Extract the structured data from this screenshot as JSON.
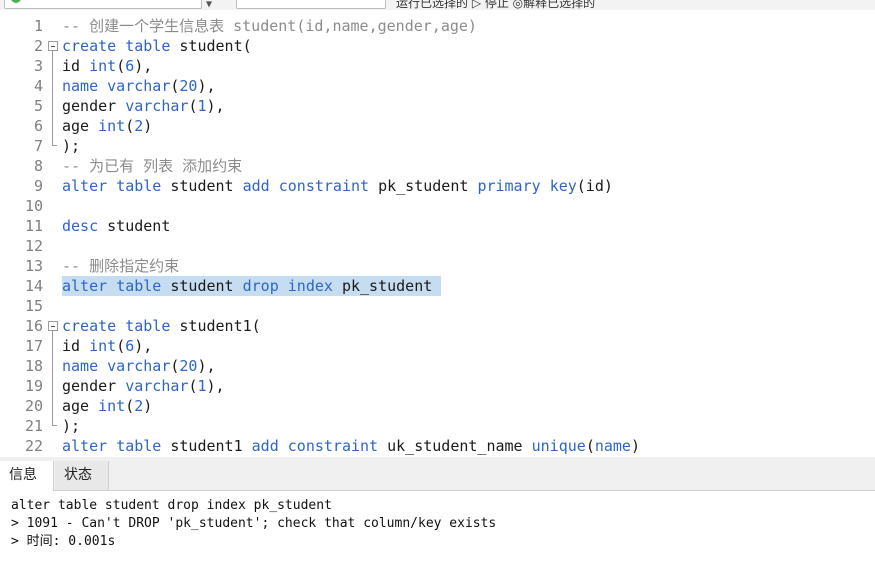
{
  "toolbar": {
    "hint": "运行已选择的 ▷ 停止 ◎解释已选择的"
  },
  "editor": {
    "lines": [
      {
        "n": "1",
        "t": [
          [
            "cmt",
            "-- 创建一个学生信息表 student(id,name,gender,age)"
          ]
        ]
      },
      {
        "n": "2",
        "t": [
          [
            "kw",
            "create"
          ],
          [
            "",
            ""
          ],
          [
            "",
            ""
          ],
          [
            "kw",
            " table"
          ],
          [
            "",
            " student("
          ]
        ]
      },
      {
        "n": "3",
        "t": [
          [
            "",
            "id "
          ],
          [
            "kw",
            "int"
          ],
          [
            "",
            "("
          ],
          [
            "num",
            "6"
          ],
          [
            "",
            "),"
          ]
        ]
      },
      {
        "n": "4",
        "t": [
          [
            "kw",
            "name"
          ],
          [
            "",
            " "
          ],
          [
            "kw",
            "varchar"
          ],
          [
            "",
            "("
          ],
          [
            "num",
            "20"
          ],
          [
            "",
            "),"
          ]
        ]
      },
      {
        "n": "5",
        "t": [
          [
            "",
            "gender "
          ],
          [
            "kw",
            "varchar"
          ],
          [
            "",
            "("
          ],
          [
            "num",
            "1"
          ],
          [
            "",
            "),"
          ]
        ]
      },
      {
        "n": "6",
        "t": [
          [
            "",
            "age "
          ],
          [
            "kw",
            "int"
          ],
          [
            "",
            "("
          ],
          [
            "num",
            "2"
          ],
          [
            "",
            ")"
          ]
        ]
      },
      {
        "n": "7",
        "t": [
          [
            "",
            ");"
          ]
        ]
      },
      {
        "n": "8",
        "t": [
          [
            "cmt",
            "-- 为已有 列表 添加约束"
          ]
        ]
      },
      {
        "n": "9",
        "t": [
          [
            "kw",
            "alter"
          ],
          [
            "",
            " "
          ],
          [
            "kw",
            "table"
          ],
          [
            "",
            " student "
          ],
          [
            "kw",
            "add"
          ],
          [
            "",
            " "
          ],
          [
            "kw",
            "constraint"
          ],
          [
            "",
            " pk_student "
          ],
          [
            "kw",
            "primary"
          ],
          [
            "",
            " "
          ],
          [
            "kw",
            "key"
          ],
          [
            "",
            "(id)"
          ]
        ]
      },
      {
        "n": "10",
        "t": []
      },
      {
        "n": "11",
        "t": [
          [
            "kw",
            "desc"
          ],
          [
            "",
            " student"
          ]
        ]
      },
      {
        "n": "12",
        "t": []
      },
      {
        "n": "13",
        "t": [
          [
            "cmt",
            "-- 删除指定约束"
          ]
        ]
      },
      {
        "n": "14",
        "t": [
          [
            "kw",
            "alter"
          ],
          [
            "",
            " "
          ],
          [
            "kw",
            "table"
          ],
          [
            "",
            " student "
          ],
          [
            "kw",
            "drop"
          ],
          [
            "",
            " "
          ],
          [
            "kw",
            "index"
          ],
          [
            "",
            " pk_student "
          ]
        ],
        "selected": true
      },
      {
        "n": "15",
        "t": []
      },
      {
        "n": "16",
        "t": [
          [
            "kw",
            "create"
          ],
          [
            "",
            " "
          ],
          [
            "kw",
            "table"
          ],
          [
            "",
            " student1("
          ]
        ]
      },
      {
        "n": "17",
        "t": [
          [
            "",
            "id "
          ],
          [
            "kw",
            "int"
          ],
          [
            "",
            "("
          ],
          [
            "num",
            "6"
          ],
          [
            "",
            "),"
          ]
        ]
      },
      {
        "n": "18",
        "t": [
          [
            "kw",
            "name"
          ],
          [
            "",
            " "
          ],
          [
            "kw",
            "varchar"
          ],
          [
            "",
            "("
          ],
          [
            "num",
            "20"
          ],
          [
            "",
            "),"
          ]
        ]
      },
      {
        "n": "19",
        "t": [
          [
            "",
            "gender "
          ],
          [
            "kw",
            "varchar"
          ],
          [
            "",
            "("
          ],
          [
            "num",
            "1"
          ],
          [
            "",
            "),"
          ]
        ]
      },
      {
        "n": "20",
        "t": [
          [
            "",
            "age "
          ],
          [
            "kw",
            "int"
          ],
          [
            "",
            "("
          ],
          [
            "num",
            "2"
          ],
          [
            "",
            ")"
          ]
        ]
      },
      {
        "n": "21",
        "t": [
          [
            "",
            ");"
          ]
        ]
      },
      {
        "n": "22",
        "t": [
          [
            "kw",
            "alter"
          ],
          [
            "",
            " "
          ],
          [
            "kw",
            "table"
          ],
          [
            "",
            " student1 "
          ],
          [
            "kw",
            "add"
          ],
          [
            "",
            " "
          ],
          [
            "kw",
            "constraint"
          ],
          [
            "",
            " uk_student_name "
          ],
          [
            "kw",
            "unique"
          ],
          [
            "",
            "("
          ],
          [
            "kw",
            "name"
          ],
          [
            "",
            ")"
          ]
        ]
      }
    ]
  },
  "panel": {
    "tabs": [
      {
        "label": "信息",
        "active": true
      },
      {
        "label": "状态",
        "active": false
      }
    ],
    "output": [
      "alter table student drop index pk_student",
      "> 1091 - Can't DROP 'pk_student'; check that column/key exists",
      "> 时间: 0.001s"
    ]
  }
}
